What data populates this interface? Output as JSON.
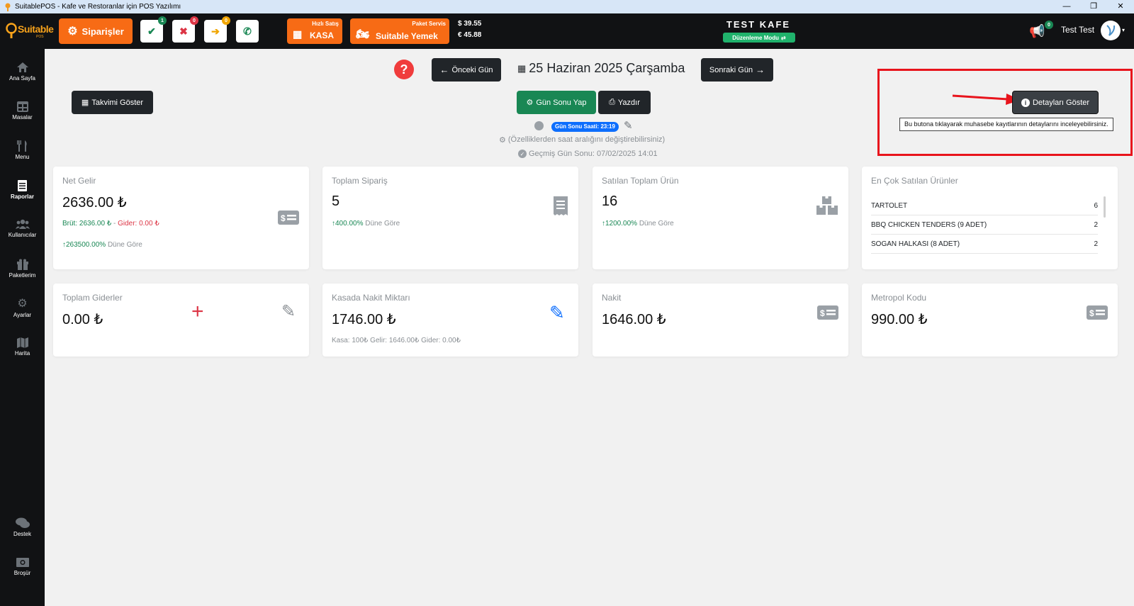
{
  "window": {
    "title": "SuitablePOS - Kafe ve Restoranlar için POS Yazılımı",
    "min": "—",
    "max": "❐",
    "close": "✕"
  },
  "topbar": {
    "logo_text": "Suitable",
    "logo_sub": "POS",
    "orders_label": "Siparişler",
    "badges": {
      "check": "1",
      "cross": "0",
      "arrow": "0"
    },
    "kasa_top": "Hızlı Satış",
    "kasa_label": "KASA",
    "yemek_top": "Paket Servis",
    "yemek_label": "Suitable Yemek",
    "usd": "$  39.55",
    "eur": "€  45.88",
    "cafe_name": "TEST KAFE",
    "edit_mode": "Düzenleme Modu",
    "notif_count": "0",
    "user_name": "Test Test"
  },
  "sidebar": {
    "items": [
      {
        "label": "Ana Sayfa"
      },
      {
        "label": "Masalar"
      },
      {
        "label": "Menu"
      },
      {
        "label": "Raporlar"
      },
      {
        "label": "Kullanıcılar"
      },
      {
        "label": "Paketlerim"
      },
      {
        "label": "Ayarlar"
      },
      {
        "label": "Harita"
      },
      {
        "label": "Destek"
      },
      {
        "label": "Broşür"
      }
    ]
  },
  "controls": {
    "prev_day": "Önceki Gün",
    "date": "25 Haziran 2025 Çarşamba",
    "next_day": "Sonraki Gün",
    "show_calendar": "Takvimi Göster",
    "end_of_day": "Gün Sonu Yap",
    "print": "Yazdır",
    "show_details": "Detayları Göster",
    "tooltip": "Bu butona tıklayarak muhasebe kayıtlarının detaylarını inceleyebilirsiniz.",
    "eod_time": "Gün Sonu Saati: 23:19",
    "hint": "(Özelliklerden saat aralığını değiştirebilirsiniz)",
    "past_eod": "Geçmiş Gün Sonu: 07/02/2025 14:01"
  },
  "cards": {
    "net_income": {
      "title": "Net Gelir",
      "value": "2636.00 ₺",
      "gross": "Brüt: 2636.00 ₺",
      "sep": " - ",
      "expense": "Gider: 0.00 ₺",
      "change": "263500.00%",
      "vs": " Düne Göre"
    },
    "total_orders": {
      "title": "Toplam Sipariş",
      "value": "5",
      "change": "400.00%",
      "vs": " Düne Göre"
    },
    "products_sold": {
      "title": "Satılan Toplam Ürün",
      "value": "16",
      "change": "1200.00%",
      "vs": " Düne Göre"
    },
    "top_products": {
      "title": "En Çok Satılan Ürünler",
      "rows": [
        {
          "name": "TARTOLET",
          "qty": "6"
        },
        {
          "name": "BBQ CHICKEN TENDERS (9 ADET)",
          "qty": "2"
        },
        {
          "name": "SOGAN HALKASI (8 ADET)",
          "qty": "2"
        }
      ]
    },
    "total_expenses": {
      "title": "Toplam Giderler",
      "value": "0.00 ₺"
    },
    "cash_in_register": {
      "title": "Kasada Nakit Miktarı",
      "value": "1746.00 ₺",
      "detail": "Kasa: 100₺ Gelir: 1646.00₺ Gider: 0.00₺"
    },
    "cash": {
      "title": "Nakit",
      "value": "1646.00 ₺"
    },
    "metropol": {
      "title": "Metropol Kodu",
      "value": "990.00 ₺"
    }
  },
  "colors": {
    "accent": "#f76b15",
    "dark": "#111214",
    "success": "#198754",
    "highlight": "#e8141c"
  }
}
